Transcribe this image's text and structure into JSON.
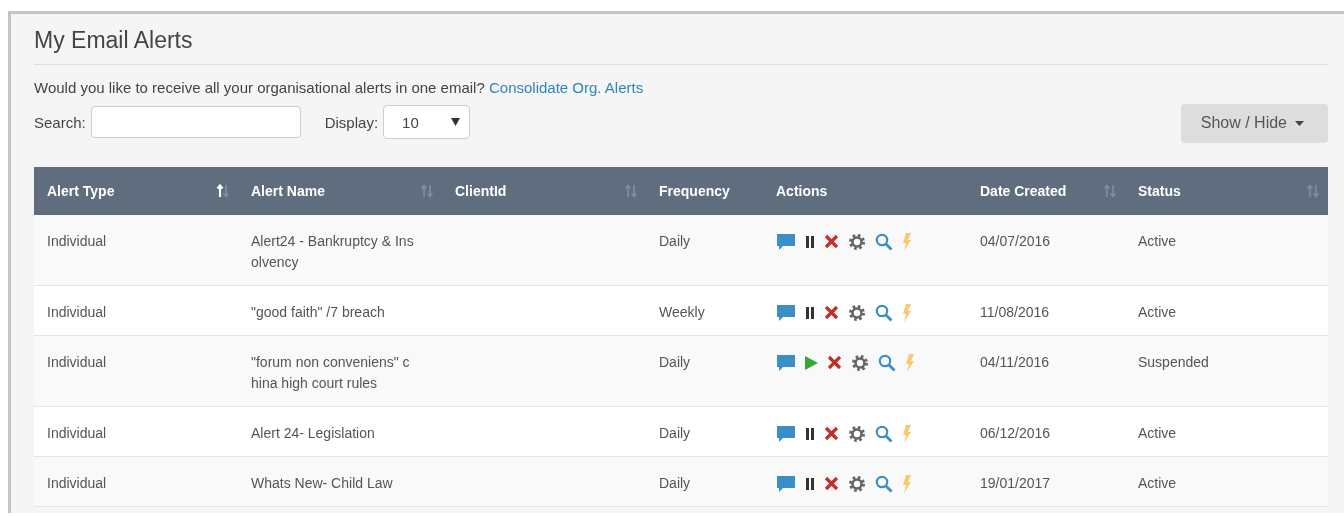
{
  "title": "My Email Alerts",
  "prompt": {
    "text": "Would you like to receive all your organisational alerts in one email?",
    "link": "Consolidate Org. Alerts"
  },
  "search": {
    "label": "Search:"
  },
  "display": {
    "label": "Display:",
    "value": "10"
  },
  "show_hide_button": "Show / Hide",
  "table": {
    "columns": [
      {
        "label": "Alert Type",
        "sortable": true,
        "sorted": true
      },
      {
        "label": "Alert Name",
        "sortable": true,
        "sorted": false
      },
      {
        "label": "ClientId",
        "sortable": true,
        "sorted": false
      },
      {
        "label": "Frequency",
        "sortable": false
      },
      {
        "label": "Actions",
        "sortable": false
      },
      {
        "label": "Date Created",
        "sortable": true,
        "sorted": false
      },
      {
        "label": "Status",
        "sortable": true,
        "sorted": false
      }
    ],
    "rows": [
      {
        "alert_type": "Individual",
        "alert_name": "Alert24 - Bankruptcy & Insolvency",
        "frequency": "Daily",
        "paused": false,
        "date_created": "04/07/2016",
        "status": "Active"
      },
      {
        "alert_type": "Individual",
        "alert_name": "\"good faith\" /7 breach",
        "frequency": "Weekly",
        "paused": false,
        "date_created": "11/08/2016",
        "status": "Active"
      },
      {
        "alert_type": "Individual",
        "alert_name": "\"forum non conveniens\" china high court rules",
        "frequency": "Daily",
        "paused": true,
        "date_created": "04/11/2016",
        "status": "Suspended"
      },
      {
        "alert_type": "Individual",
        "alert_name": "Alert 24- Legislation",
        "frequency": "Daily",
        "paused": false,
        "date_created": "06/12/2016",
        "status": "Active"
      },
      {
        "alert_type": "Individual",
        "alert_name": "Whats New- Child Law",
        "frequency": "Daily",
        "paused": false,
        "date_created": "19/01/2017",
        "status": "Active"
      }
    ]
  }
}
